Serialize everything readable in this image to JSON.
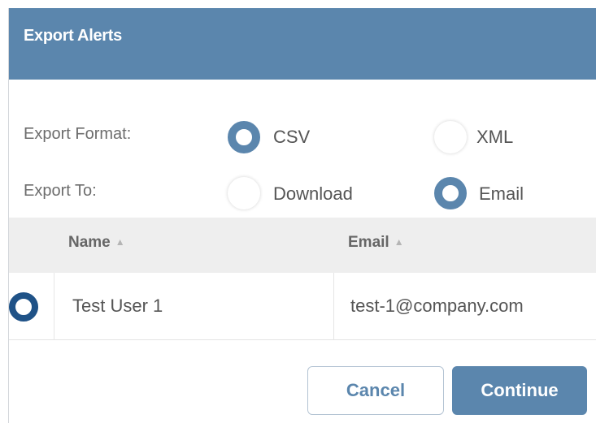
{
  "dialog": {
    "title": "Export Alerts"
  },
  "form": {
    "format_label": "Export Format:",
    "format_options": [
      {
        "label": "CSV",
        "selected": true
      },
      {
        "label": "XML",
        "selected": false
      }
    ],
    "destination_label": "Export To:",
    "destination_options": [
      {
        "label": "Download",
        "selected": false
      },
      {
        "label": "Email",
        "selected": true
      }
    ]
  },
  "table": {
    "columns": [
      "Name",
      "Email"
    ],
    "rows": [
      {
        "name": "Test User 1",
        "email": "test-1@company.com",
        "selected": true
      }
    ]
  },
  "actions": {
    "cancel_label": "Cancel",
    "continue_label": "Continue"
  },
  "colors": {
    "header_bg": "#5b86ad",
    "accent": "#5b86ad",
    "row_radio": "#1f5287"
  }
}
